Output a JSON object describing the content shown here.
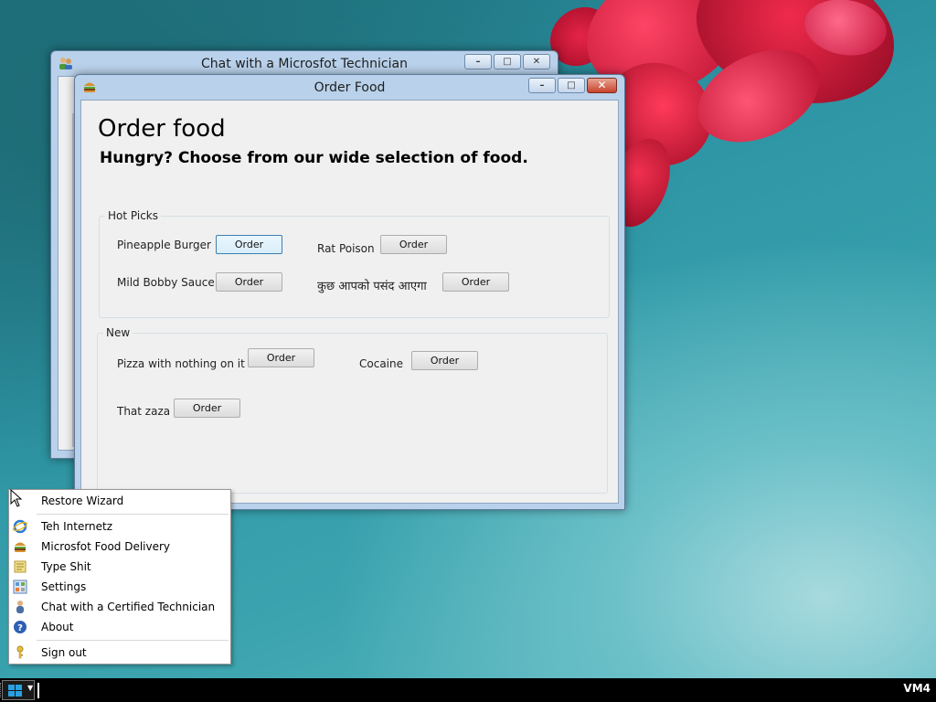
{
  "chat_window": {
    "title": "Chat with a Microsfot Technician",
    "icon": "people-icon"
  },
  "food_window": {
    "title": "Order Food",
    "icon": "burger-icon",
    "heading": "Order food",
    "subheading": "Hungry? Choose from our wide selection of food.",
    "hot_picks": {
      "label": "Hot Picks",
      "items": [
        {
          "name": "Pineapple Burger",
          "button": "Order"
        },
        {
          "name": "Rat Poison",
          "button": "Order"
        },
        {
          "name": "Mild Bobby Sauce",
          "button": "Order"
        },
        {
          "name": "कुछ आपको पसंद आएगा",
          "button": "Order"
        }
      ]
    },
    "new": {
      "label": "New",
      "items": [
        {
          "name": "Pizza with nothing on it",
          "button": "Order"
        },
        {
          "name": "Cocaine",
          "button": "Order"
        },
        {
          "name": "That zaza",
          "button": "Order"
        }
      ]
    }
  },
  "start_menu": {
    "items": [
      {
        "label": "Restore Wizard",
        "icon": "none"
      },
      {
        "label": "Teh Internetz",
        "icon": "internet-explorer-icon"
      },
      {
        "label": "Microsfot Food Delivery",
        "icon": "burger-icon"
      },
      {
        "label": "Type Shit",
        "icon": "notepad-icon"
      },
      {
        "label": "Settings",
        "icon": "settings-icon"
      },
      {
        "label": "Chat with a Certified Technician",
        "icon": "technician-icon"
      },
      {
        "label": "About",
        "icon": "help-icon"
      },
      {
        "label": "Sign out",
        "icon": "key-icon"
      }
    ]
  },
  "taskbar": {
    "vm_label": "VM4"
  },
  "colors": {
    "titlebar": "#b9d1ea",
    "close_button": "#c7432b",
    "desktop": "#2a8f9f",
    "flower": "#d81a3c",
    "taskbar": "#000000"
  }
}
